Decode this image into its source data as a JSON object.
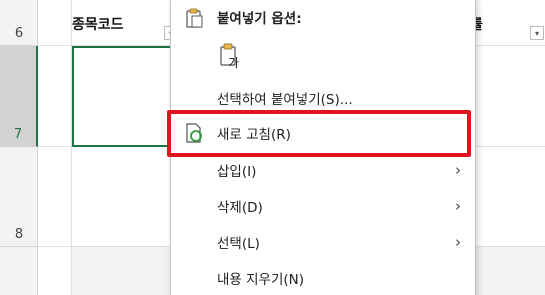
{
  "rows": [
    {
      "num": "6"
    },
    {
      "num": "7"
    },
    {
      "num": "8"
    }
  ],
  "headers": {
    "col_code": "종목코드",
    "col_partial": "률"
  },
  "filter_arrow": "▾",
  "menu": {
    "paste_options_title": "붙여넣기 옵션:",
    "paste_value_icon_text": "가",
    "paste_special": "선택하여 붙여넣기(S)...",
    "refresh": "새로 고침(R)",
    "insert": "삽입(I)",
    "delete": "삭제(D)",
    "select": "선택(L)",
    "clear_contents": "내용 지우기(N)",
    "chevron": "›"
  },
  "colors": {
    "accent_green": "#217346",
    "highlight_red": "#e0151f"
  }
}
